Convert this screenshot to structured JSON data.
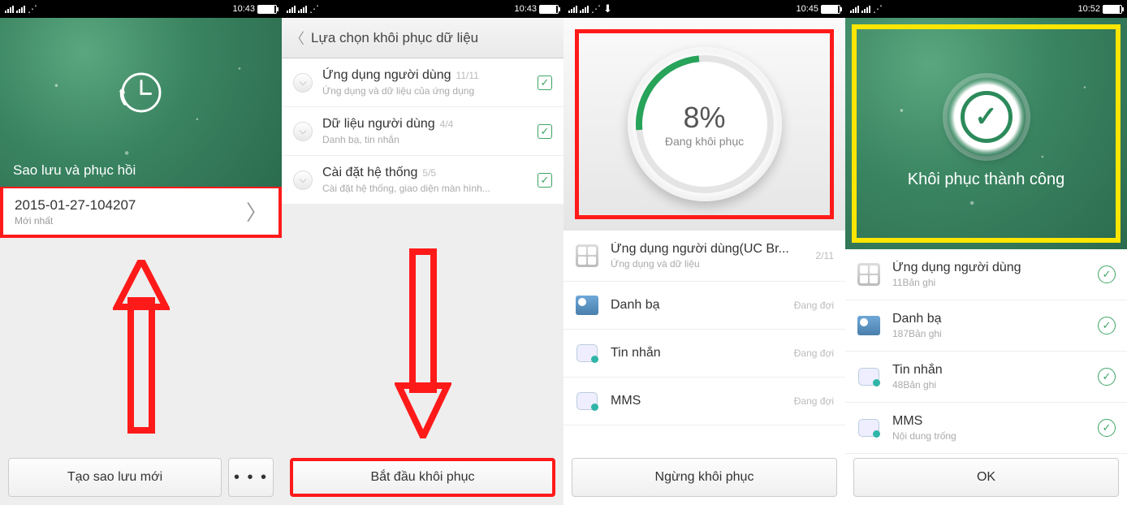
{
  "status": {
    "time1": "10:43",
    "time2": "10:43",
    "time3": "10:45",
    "time4": "10:52"
  },
  "s1": {
    "hero_title": "Sao lưu và phục hồi",
    "backup_name": "2015-01-27-104207",
    "backup_sub": "Mới nhất",
    "btn_new": "Tạo sao lưu mới",
    "btn_more": "• • •"
  },
  "s2": {
    "nav_title": "Lựa chọn khôi phục dữ liệu",
    "opts": [
      {
        "title": "Ứng dụng người dùng",
        "count": "11/11",
        "sub": "Ứng dụng và dữ liệu của ứng dụng"
      },
      {
        "title": "Dữ liệu người dùng",
        "count": "4/4",
        "sub": "Danh bạ, tin nhắn"
      },
      {
        "title": "Cài đặt hệ thống",
        "count": "5/5",
        "sub": "Cài đặt hệ thống, giao diện màn hình..."
      }
    ],
    "btn_start": "Bắt đầu khôi phục"
  },
  "s3": {
    "pct": "8%",
    "pct_label": "Đang khôi phục",
    "items": [
      {
        "title": "Ứng dụng người dùng(UC Br...",
        "sub": "Ứng dụng và dữ liệu",
        "status": "2/11"
      },
      {
        "title": "Danh bạ",
        "sub": "",
        "status": "Đang đợi"
      },
      {
        "title": "Tin nhắn",
        "sub": "",
        "status": "Đang đợi"
      },
      {
        "title": "MMS",
        "sub": "",
        "status": "Đang đợi"
      }
    ],
    "btn_stop": "Ngừng khôi phục"
  },
  "s4": {
    "success": "Khôi phục thành công",
    "items": [
      {
        "title": "Ứng dụng người dùng",
        "sub": "11Bản ghi"
      },
      {
        "title": "Danh bạ",
        "sub": "187Bản ghi"
      },
      {
        "title": "Tin nhắn",
        "sub": "48Bản ghi"
      },
      {
        "title": "MMS",
        "sub": "Nội dung trống"
      }
    ],
    "btn_ok": "OK"
  }
}
